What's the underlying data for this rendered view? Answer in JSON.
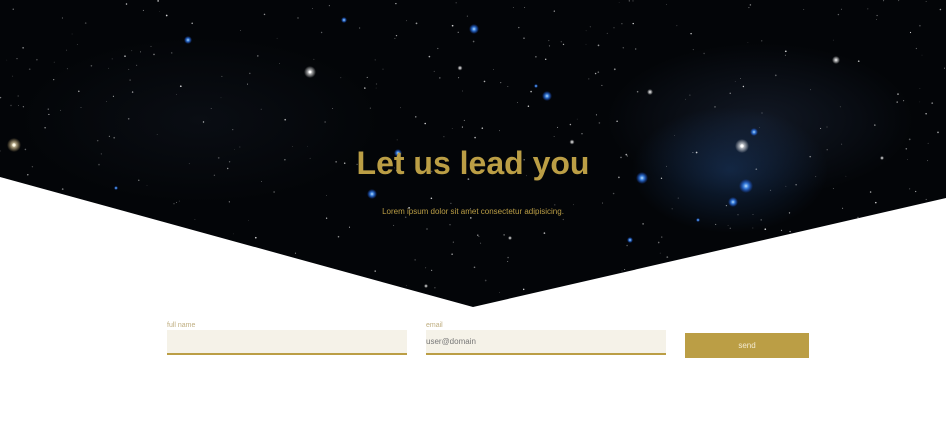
{
  "hero": {
    "title": "Let us lead you",
    "subtitle": "Lorem ipsum dolor sit amet consectetur adipisicing."
  },
  "form": {
    "full_name": {
      "label": "full name",
      "value": "",
      "placeholder": ""
    },
    "email": {
      "label": "email",
      "value": "",
      "placeholder": "user@domain"
    },
    "send_label": "send"
  },
  "colors": {
    "accent": "#bb9e45",
    "input_background": "#f5f2e8",
    "hero_background": "#030508"
  }
}
